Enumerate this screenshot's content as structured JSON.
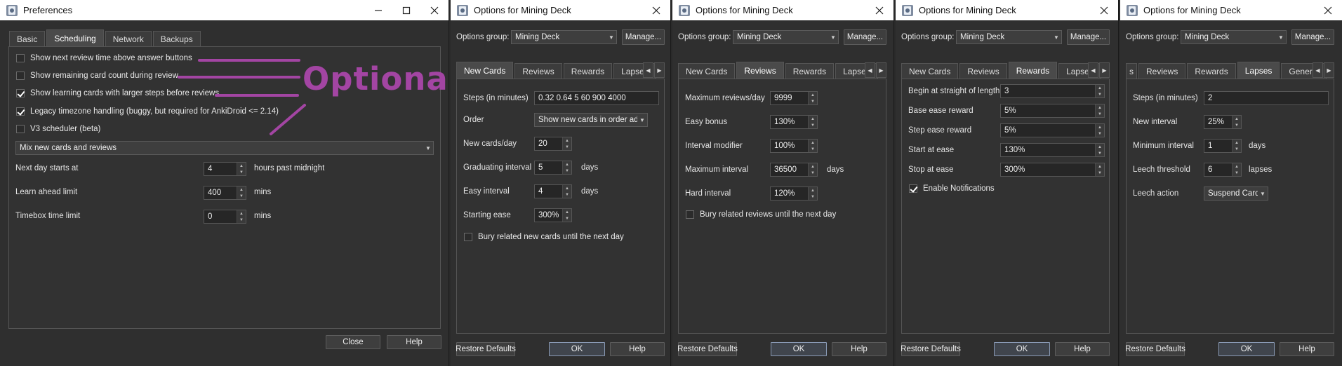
{
  "preferences": {
    "title": "Preferences",
    "tabs": [
      "Basic",
      "Scheduling",
      "Network",
      "Backups"
    ],
    "active_tab": "Scheduling",
    "checkboxes": [
      {
        "label": "Show next review time above answer buttons",
        "checked": false
      },
      {
        "label": "Show remaining card count during review",
        "checked": false
      },
      {
        "label": "Show learning cards with larger steps before reviews",
        "checked": true
      },
      {
        "label": "Legacy timezone handling (buggy, but required for AnkiDroid <= 2.14)",
        "checked": true
      },
      {
        "label": "V3 scheduler (beta)",
        "checked": false
      }
    ],
    "mix_select": "Mix new cards and reviews",
    "next_day": {
      "label": "Next day starts at",
      "value": "4",
      "unit": "hours past midnight"
    },
    "learn_ahead": {
      "label": "Learn ahead limit",
      "value": "400",
      "unit": "mins"
    },
    "timebox": {
      "label": "Timebox time limit",
      "value": "0",
      "unit": "mins"
    },
    "close_label": "Close",
    "help_label": "Help",
    "annotation": {
      "text": "Optional",
      "color": "#a345a3"
    }
  },
  "options_title": "Options for Mining Deck",
  "options_group_label": "Options group:",
  "options_group_value": "Mining Deck",
  "manage_label": "Manage...",
  "restore_label": "Restore Defaults",
  "ok_label": "OK",
  "help_label": "Help",
  "new_cards": {
    "tabs": [
      "New Cards",
      "Reviews",
      "Rewards",
      "Lapses"
    ],
    "active_tab": "New Cards",
    "steps_label": "Steps (in minutes)",
    "steps_value": "0.32 0.64 5 60 900 4000",
    "order_label": "Order",
    "order_value": "Show new cards in order added",
    "per_day_label": "New cards/day",
    "per_day_value": "20",
    "grad_label": "Graduating interval",
    "grad_value": "5",
    "grad_unit": "days",
    "easy_label": "Easy interval",
    "easy_value": "4",
    "easy_unit": "days",
    "ease_label": "Starting ease",
    "ease_value": "300%",
    "bury_label": "Bury related new cards until the next day"
  },
  "reviews": {
    "tabs": [
      "New Cards",
      "Reviews",
      "Rewards",
      "Lapses"
    ],
    "active_tab": "Reviews",
    "max_label": "Maximum reviews/day",
    "max_value": "9999",
    "bonus_label": "Easy bonus",
    "bonus_value": "130%",
    "mod_label": "Interval modifier",
    "mod_value": "100%",
    "maxint_label": "Maximum interval",
    "maxint_value": "36500",
    "maxint_unit": "days",
    "hard_label": "Hard interval",
    "hard_value": "120%",
    "bury_label": "Bury related reviews until the next day"
  },
  "rewards": {
    "tabs": [
      "New Cards",
      "Reviews",
      "Rewards",
      "Lapses"
    ],
    "active_tab": "Rewards",
    "begin_label": "Begin at straight of length",
    "begin_value": "3",
    "base_label": "Base ease reward",
    "base_value": "5%",
    "step_label": "Step ease reward",
    "step_value": "5%",
    "start_label": "Start at ease",
    "start_value": "130%",
    "stop_label": "Stop at ease",
    "stop_value": "300%",
    "notif_label": "Enable Notifications"
  },
  "lapses": {
    "tabs": [
      "s",
      "Reviews",
      "Rewards",
      "Lapses",
      "General"
    ],
    "active_tab": "Lapses",
    "steps_label": "Steps (in minutes)",
    "steps_value": "2",
    "newint_label": "New interval",
    "newint_value": "25%",
    "minint_label": "Minimum interval",
    "minint_value": "1",
    "minint_unit": "days",
    "leech_label": "Leech threshold",
    "leech_value": "6",
    "leech_unit": "lapses",
    "action_label": "Leech action",
    "action_value": "Suspend Card"
  }
}
